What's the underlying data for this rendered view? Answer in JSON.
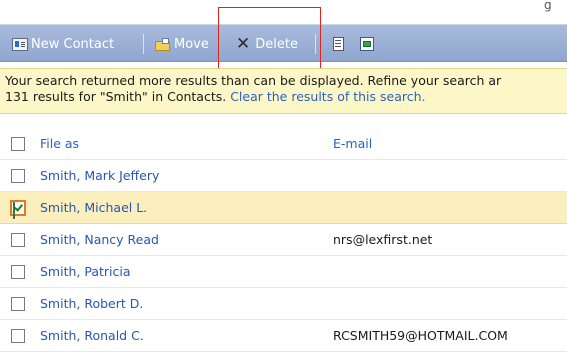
{
  "topbar": {
    "fragment": "g"
  },
  "toolbar": {
    "new_contact": "New Contact",
    "move": "Move",
    "delete": "Delete"
  },
  "info": {
    "line1": "Your search returned more results than can be displayed. Refine your search ar",
    "line2_prefix": "131 results for \"Smith\" in Contacts. ",
    "clear_link": "Clear the results of this search."
  },
  "table": {
    "columns": {
      "file_as": "File as",
      "email": "E-mail"
    },
    "rows": [
      {
        "name": "Smith, Mark Jeffery",
        "email": "",
        "checked": false
      },
      {
        "name": "Smith, Michael L.",
        "email": "",
        "checked": true
      },
      {
        "name": "Smith, Nancy Read",
        "email": "nrs@lexfirst.net",
        "checked": false
      },
      {
        "name": "Smith, Patricia",
        "email": "",
        "checked": false
      },
      {
        "name": "Smith, Robert D.",
        "email": "",
        "checked": false
      },
      {
        "name": "Smith, Ronald C.",
        "email": "RCSMITH59@HOTMAIL.COM",
        "checked": false
      }
    ]
  },
  "colors": {
    "toolbar": "#9bb0d6",
    "info_bg": "#fdf6c7",
    "selected_row": "#fbefbe",
    "link": "#2a62c4",
    "highlight": "#e0231b"
  }
}
